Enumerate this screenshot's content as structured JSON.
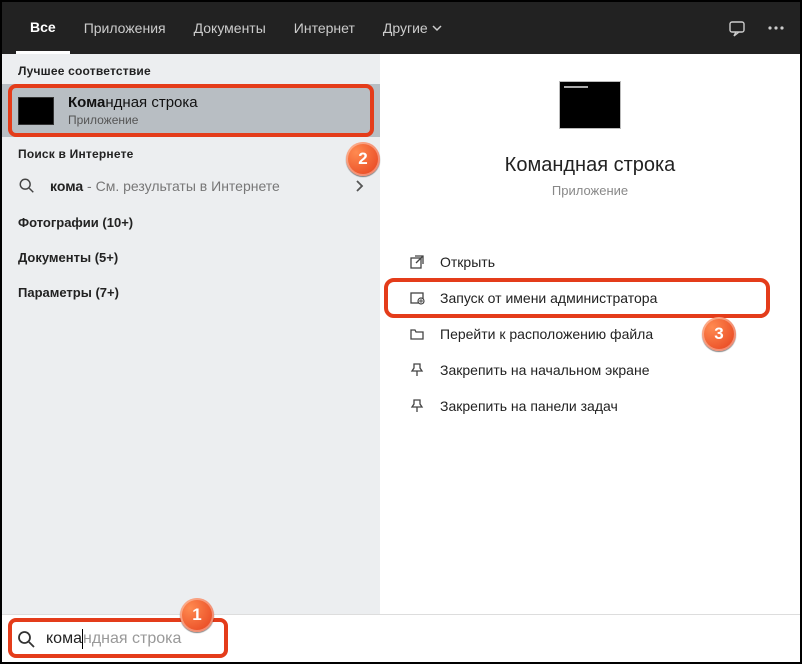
{
  "topbar": {
    "tabs": [
      {
        "label": "Все",
        "active": true
      },
      {
        "label": "Приложения",
        "active": false
      },
      {
        "label": "Документы",
        "active": false
      },
      {
        "label": "Интернет",
        "active": false
      },
      {
        "label": "Другие",
        "active": false,
        "dropdown": true
      }
    ]
  },
  "left": {
    "bestMatchLabel": "Лучшее соответствие",
    "result": {
      "titleMatched": "Кома",
      "titleRest": "ндная строка",
      "subtitle": "Приложение"
    },
    "webSearchLabel": "Поиск в Интернете",
    "webRow": {
      "queryMatched": "кома",
      "hint": " - См. результаты в Интернете"
    },
    "groups": [
      "Фотографии (10+)",
      "Документы (5+)",
      "Параметры (7+)"
    ]
  },
  "detail": {
    "title": "Командная строка",
    "subtitle": "Приложение",
    "actions": [
      {
        "icon": "open-icon",
        "label": "Открыть"
      },
      {
        "icon": "run-as-admin-icon",
        "label": "Запуск от имени администратора",
        "highlight": true
      },
      {
        "icon": "open-location-icon",
        "label": "Перейти к расположению файла"
      },
      {
        "icon": "pin-start-icon",
        "label": "Закрепить на начальном экране"
      },
      {
        "icon": "pin-taskbar-icon",
        "label": "Закрепить на панели задач"
      }
    ]
  },
  "search": {
    "typed": "кома",
    "suggestion": "ндная строка"
  },
  "annotations": {
    "a1": "1",
    "a2": "2",
    "a3": "3"
  },
  "colors": {
    "highlight": "#e43c1a"
  }
}
